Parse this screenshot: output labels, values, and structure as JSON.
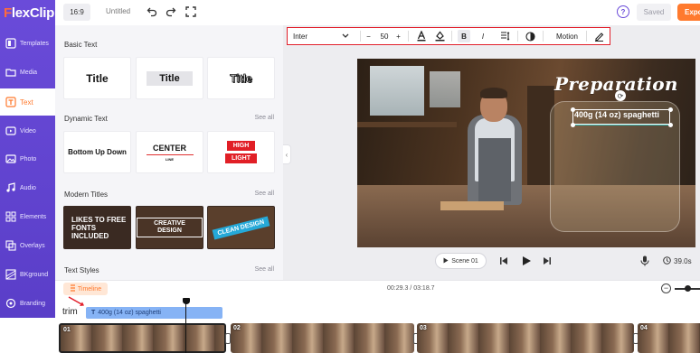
{
  "app": {
    "brand": "FlexClip",
    "brand_initial": "F",
    "brand_rest": "lexClip"
  },
  "topbar": {
    "ratio": "16:9",
    "title": "Untitled",
    "help": "?",
    "saved": "Saved",
    "export": "Export"
  },
  "sidebar": {
    "items": [
      {
        "label": "Templates",
        "icon": "templates-icon"
      },
      {
        "label": "Media",
        "icon": "media-icon"
      },
      {
        "label": "Text",
        "icon": "text-icon",
        "active": true
      },
      {
        "label": "Video",
        "icon": "video-icon"
      },
      {
        "label": "Photo",
        "icon": "photo-icon"
      },
      {
        "label": "Audio",
        "icon": "audio-icon"
      },
      {
        "label": "Elements",
        "icon": "elements-icon"
      },
      {
        "label": "Overlays",
        "icon": "overlays-icon"
      },
      {
        "label": "BKground",
        "icon": "background-icon"
      },
      {
        "label": "Branding",
        "icon": "branding-icon"
      }
    ]
  },
  "panel": {
    "basic": {
      "title": "Basic Text",
      "cards": [
        "Title",
        "Title",
        "Title"
      ]
    },
    "dynamic": {
      "title": "Dynamic Text",
      "see_all": "See all",
      "bottom_up": "Bottom Up Down",
      "center": "CENTER",
      "center_sub": "LINE",
      "high": "HIGH",
      "light": "LIGHT"
    },
    "modern": {
      "title": "Modern Titles",
      "see_all": "See all",
      "card1": "LIKES TO FREE FONTS INCLUDED",
      "card2": "CREATIVE DESIGN",
      "card3": "CLEAN DESIGN"
    },
    "styles": {
      "title": "Text Styles",
      "see_all": "See all"
    }
  },
  "text_toolbar": {
    "font": "Inter",
    "size": "50",
    "minus": "−",
    "plus": "+",
    "motion": "Motion"
  },
  "canvas": {
    "heading": "Preparation",
    "selected_text": "400g (14 oz) spaghetti"
  },
  "playback": {
    "scene": "Scene 01",
    "duration": "39.0s"
  },
  "timeline": {
    "button": "Timeline",
    "time": "00:29.3 / 03:18.7",
    "track_label": "trim",
    "text_clip": "400g (14 oz) spaghetti",
    "clips": [
      "01",
      "02",
      "03",
      "04"
    ]
  },
  "colors": {
    "accent": "#ff7a2e",
    "sidebar": "#6a4bd9",
    "highlight_border": "#e21f2a"
  }
}
